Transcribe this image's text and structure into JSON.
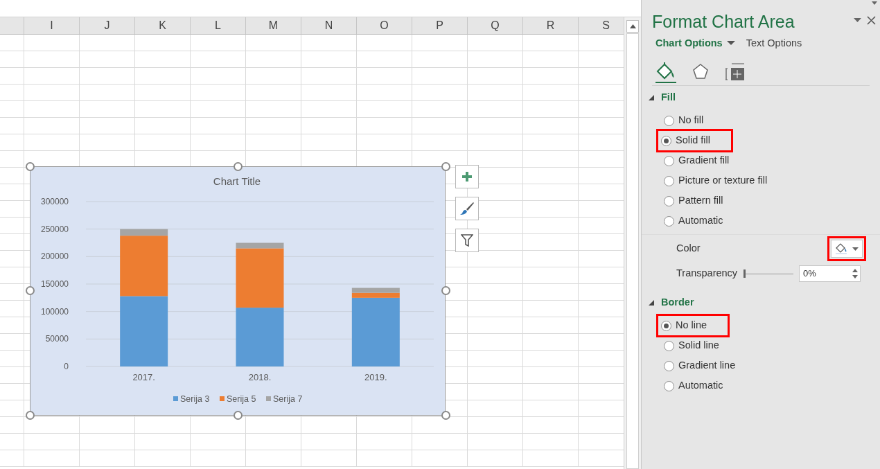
{
  "sheet": {
    "columns": [
      "I",
      "J",
      "K",
      "L",
      "M",
      "N",
      "O",
      "P",
      "Q",
      "R",
      "S"
    ]
  },
  "chart": {
    "chart_data": {
      "type": "bar",
      "title": "Chart Title",
      "grid": true,
      "legend": true,
      "categories": [
        "2017.",
        "2018.",
        "2019."
      ],
      "stacked": true,
      "orientation": "vertical",
      "ylim": [
        0,
        300000
      ],
      "yticks": [
        0,
        50000,
        100000,
        150000,
        200000,
        250000,
        300000
      ],
      "series": [
        {
          "name": "Serija 3",
          "color": "#5b9bd5",
          "values": [
            128000,
            107000,
            125000
          ]
        },
        {
          "name": "Serija 5",
          "color": "#ed7d31",
          "values": [
            110000,
            108000,
            9000
          ]
        },
        {
          "name": "Serija 7",
          "color": "#a5a5a5",
          "values": [
            12000,
            10000,
            9000
          ]
        }
      ]
    }
  },
  "panel": {
    "title": "Format Chart Area",
    "tabs": [
      {
        "label": "Chart Options",
        "selected": true
      },
      {
        "label": "Text Options",
        "selected": false
      }
    ],
    "icon_tabs": [
      {
        "selected": true
      },
      {
        "selected": false
      },
      {
        "selected": false
      }
    ],
    "sections": [
      {
        "title": "Fill",
        "expanded": true,
        "options": [
          {
            "label": "No fill",
            "selected": false,
            "highlighted": false
          },
          {
            "label": "Solid fill",
            "selected": true,
            "highlighted": true
          },
          {
            "label": "Gradient fill",
            "selected": false,
            "highlighted": false
          },
          {
            "label": "Picture or texture fill",
            "selected": false,
            "highlighted": false
          },
          {
            "label": "Pattern fill",
            "selected": false,
            "highlighted": false
          },
          {
            "label": "Automatic",
            "selected": false,
            "highlighted": false
          }
        ],
        "color": {
          "label": "Color",
          "highlighted": true
        },
        "transparency": {
          "label": "Transparency",
          "level": 0,
          "value": "0%"
        }
      },
      {
        "title": "Border",
        "expanded": true,
        "options": [
          {
            "label": "No line",
            "selected": true,
            "highlighted": true
          },
          {
            "label": "Solid line",
            "selected": false,
            "highlighted": false
          },
          {
            "label": "Gradient line",
            "selected": false,
            "highlighted": false
          },
          {
            "label": "Automatic",
            "selected": false,
            "highlighted": false
          }
        ]
      }
    ]
  }
}
